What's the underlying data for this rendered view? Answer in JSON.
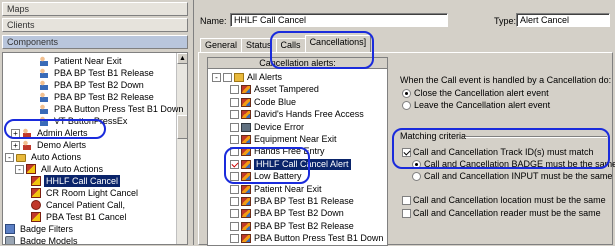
{
  "nav": {
    "maps": "Maps",
    "clients": "Clients",
    "components": "Components"
  },
  "tree": [
    {
      "label": "Patient Near Exit",
      "icon": "person-icon",
      "indent": 34
    },
    {
      "label": "PBA BP Test B1 Release",
      "icon": "person-icon",
      "indent": 34
    },
    {
      "label": "PBA BP Test B2 Down",
      "icon": "person-icon",
      "indent": 34
    },
    {
      "label": "PBA BP Test B2 Release",
      "icon": "person-icon",
      "indent": 34
    },
    {
      "label": "PBA Button Press Test B1 Down",
      "icon": "person-icon",
      "indent": 34
    },
    {
      "label": "VT ButtonPressEx",
      "icon": "person-icon",
      "indent": 34
    },
    {
      "label": "Admin Alerts",
      "icon": "person2-icon",
      "indent": 6,
      "expander": "+"
    },
    {
      "label": "Demo Alerts",
      "icon": "person2-icon",
      "indent": 6,
      "expander": "+"
    },
    {
      "label": "Auto Actions",
      "icon": "folder-icon",
      "indent": 0,
      "expander": "-"
    },
    {
      "label": "All Auto Actions",
      "icon": "action-icon",
      "indent": 10,
      "expander": "-"
    },
    {
      "label": "HHLF Call Cancel",
      "icon": "action-icon",
      "indent": 26,
      "selected": true
    },
    {
      "label": "CR Room Light Cancel",
      "icon": "action-icon",
      "indent": 26
    },
    {
      "label": "Cancel Patient Call,",
      "icon": "cancel-icon",
      "indent": 26
    },
    {
      "label": "PBA Test B1 Cancel",
      "icon": "action-icon",
      "indent": 26
    },
    {
      "label": "Badge Filters",
      "icon": "badge-icon",
      "indent": 0
    },
    {
      "label": "Badge Models",
      "icon": "gear-icon",
      "indent": 0
    }
  ],
  "form": {
    "name_label": "Name:",
    "name_value": "HHLF Call Cancel",
    "type_label": "Type:",
    "type_value": "Alert Cancel"
  },
  "tabs": [
    {
      "label": "General",
      "active": false
    },
    {
      "label": "Status",
      "active": false
    },
    {
      "label": "Calls",
      "active": false
    },
    {
      "label": "Cancellations]",
      "active": true
    }
  ],
  "alerts": {
    "header": "Cancellation alerts:",
    "items": [
      {
        "label": "All Alerts",
        "checked": false,
        "kind": "fold",
        "level": 0,
        "expander": "-"
      },
      {
        "label": "Asset Tampered",
        "checked": false,
        "kind": "alert",
        "level": 1
      },
      {
        "label": "Code Blue",
        "checked": false,
        "kind": "alert",
        "level": 1
      },
      {
        "label": "David's Hands Free Access",
        "checked": false,
        "kind": "alert",
        "level": 1
      },
      {
        "label": "Device Error",
        "checked": false,
        "kind": "dev",
        "level": 1
      },
      {
        "label": "Equipment Near Exit",
        "checked": false,
        "kind": "alert",
        "level": 1
      },
      {
        "label": "Hands Free Entry",
        "checked": false,
        "kind": "alert",
        "level": 1
      },
      {
        "label": "HHLF Call Cancel  Alert",
        "checked": true,
        "kind": "alert",
        "level": 1
      },
      {
        "label": "Low Battery",
        "checked": false,
        "kind": "alert",
        "level": 1
      },
      {
        "label": "Patient Near Exit",
        "checked": false,
        "kind": "alert",
        "level": 1
      },
      {
        "label": "PBA BP Test B1 Release",
        "checked": false,
        "kind": "alert",
        "level": 1
      },
      {
        "label": "PBA BP Test B2 Down",
        "checked": false,
        "kind": "alert",
        "level": 1
      },
      {
        "label": "PBA BP Test B2 Release",
        "checked": false,
        "kind": "alert",
        "level": 1
      },
      {
        "label": "PBA Button Press Test B1 Down",
        "checked": false,
        "kind": "alert",
        "level": 1
      }
    ]
  },
  "handling": {
    "heading": "When the Call event is handled by a Cancellation do:",
    "opt_close": "Close the Cancellation alert event",
    "opt_leave": "Leave the Cancellation alert event"
  },
  "matching": {
    "heading": "Matching criteria",
    "track_id": "Call and Cancellation Track ID(s) must match",
    "badge": "Call and Cancellation BADGE must be the same",
    "input": "Call and Cancellation INPUT must be the same",
    "location": "Call and Cancellation location must be the same",
    "reader": "Call and Cancellation reader must be the same"
  }
}
